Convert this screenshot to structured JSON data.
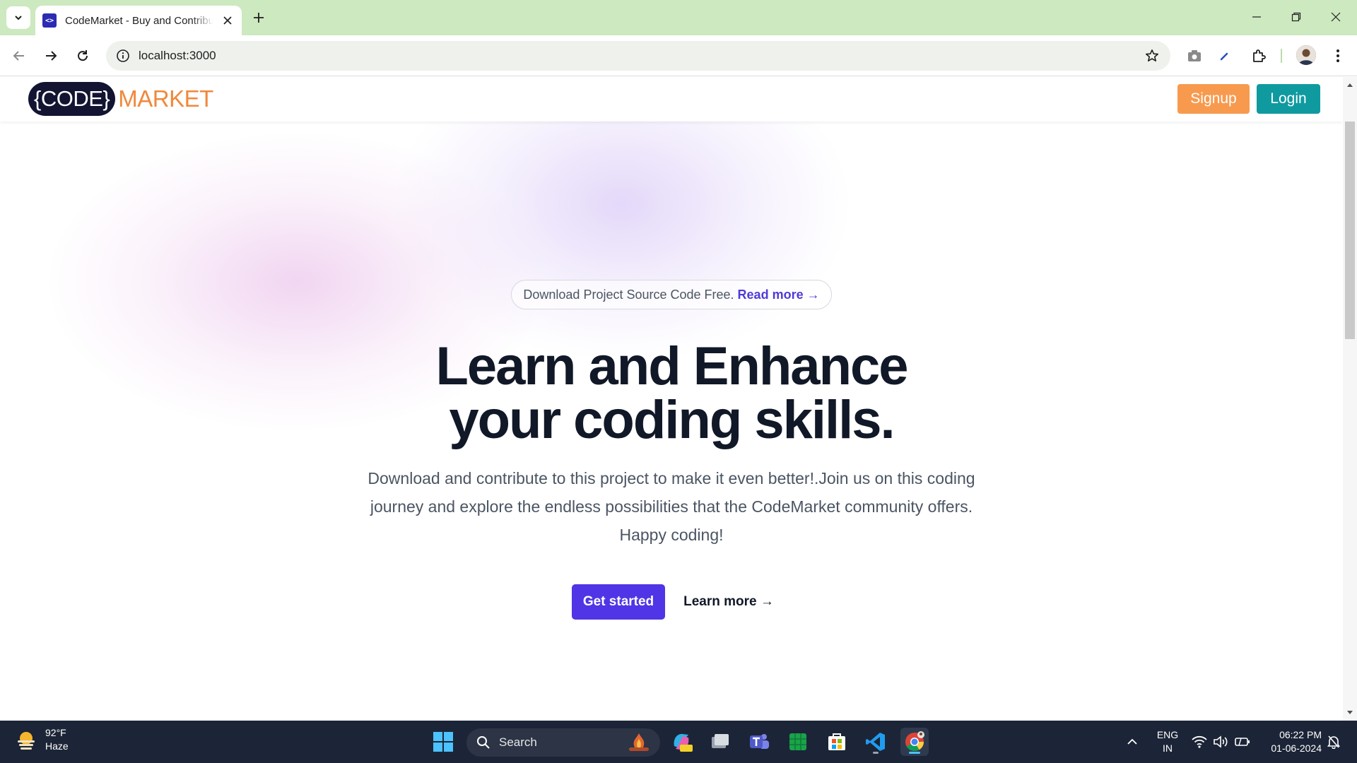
{
  "browser": {
    "tab_title": "CodeMarket - Buy and Contribute",
    "url": "localhost:3000"
  },
  "header": {
    "logo_code": "{CODE}",
    "logo_market": "MARKET",
    "signup_label": "Signup",
    "login_label": "Login"
  },
  "hero": {
    "announcement": "Download Project Source Code Free.",
    "announcement_link": "Read more →",
    "title_line1": "Learn and Enhance",
    "title_line2": "your coding skills.",
    "description": "Download and contribute to this project to make it even better!.Join us on this coding journey and explore the endless possibilities that the CodeMarket community offers. Happy coding!",
    "primary_cta": "Get started",
    "secondary_cta": "Learn more →"
  },
  "taskbar": {
    "weather_temp": "92°F",
    "weather_desc": "Haze",
    "search_label": "Search",
    "lang_line1": "ENG",
    "lang_line2": "IN",
    "time": "06:22 PM",
    "date": "01-06-2024"
  },
  "colors": {
    "tabbar_bg": "#cde9c0",
    "brand_orange": "#f79a4e",
    "brand_teal": "#0f9aa0",
    "primary_purple": "#4f35e5",
    "taskbar_bg": "#1c2537"
  }
}
